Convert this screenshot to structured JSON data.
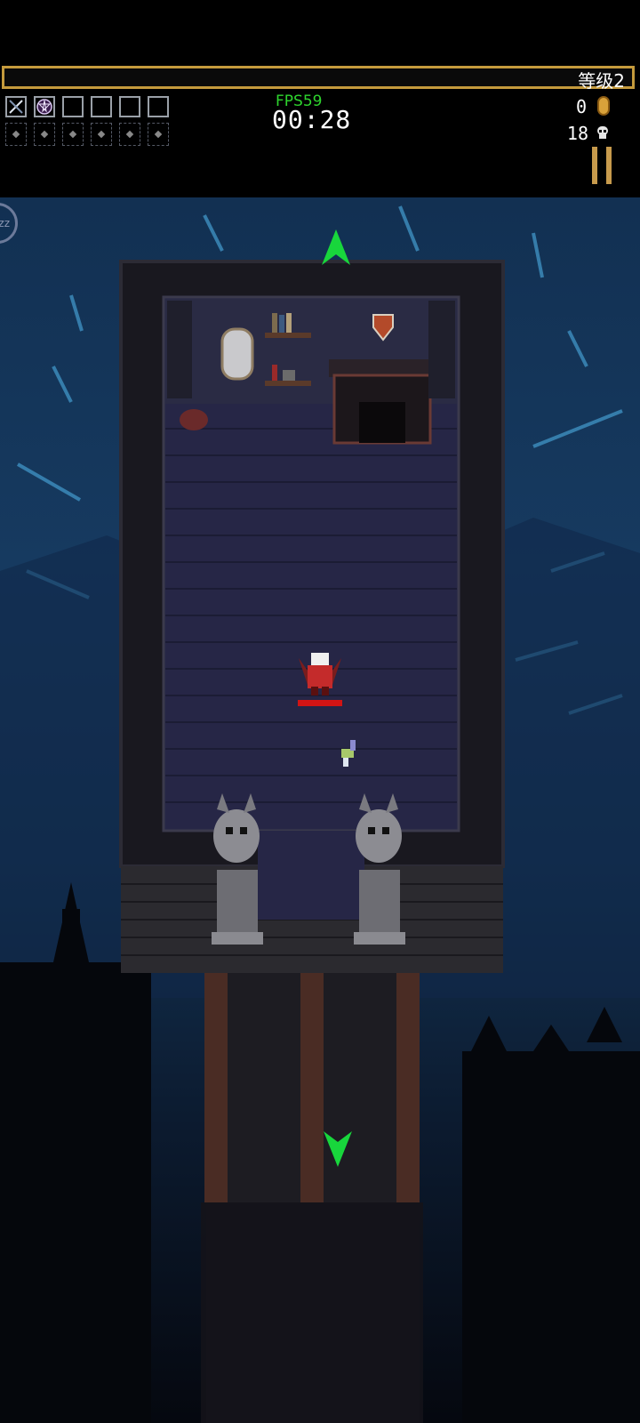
{
  "hud": {
    "level_label": "等级2",
    "xp_fraction": 0.0,
    "fps": "FPS59",
    "timer": "00:28",
    "gold": "0",
    "kills": "18",
    "weapon_slots": [
      "sword-weapon-icon",
      "pentagram-weapon-icon",
      "empty",
      "empty",
      "empty",
      "empty"
    ],
    "passive_slots": [
      "empty",
      "empty",
      "empty",
      "empty",
      "empty",
      "empty"
    ]
  },
  "scene": {
    "player_hp_fraction": 1.0,
    "colors": {
      "xp_border": "#c49a3c",
      "fps_green": "#2ed42e",
      "hp_red": "#d21414",
      "arrow_green": "#18d63c"
    }
  }
}
